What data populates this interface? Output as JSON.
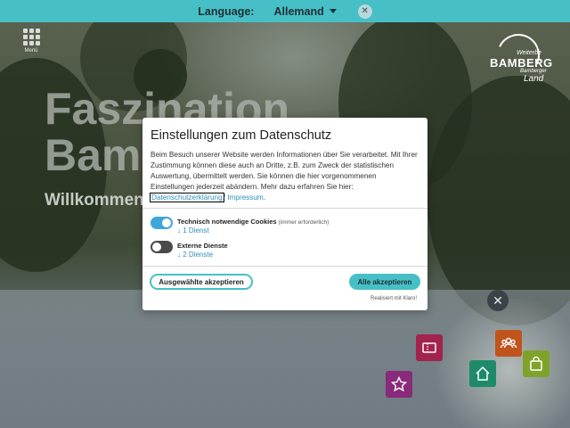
{
  "language_bar": {
    "label": "Language:",
    "selected": "Allemand",
    "close_glyph": "✕",
    "background": "#46c0c6"
  },
  "menu": {
    "label": "Menü"
  },
  "logo": {
    "line1": "Weiterbe",
    "line2": "BAMBERG",
    "line3": "Bamberger",
    "line4": "Land"
  },
  "hero": {
    "line1": "Faszination",
    "line2": "Bam",
    "subtitle": "Willkommen"
  },
  "consent": {
    "title": "Einstellungen zum Datenschutz",
    "description": "Beim Besuch unserer Website werden Informationen über Sie verarbeitet. Mit Ihrer Zustimmung können diese auch an Dritte, z.B. zum Zweck der statistischen Auswertung, übermittelt werden. Sie können die hier vorgenommenen Einstellungen jederzeit abändern. Mehr dazu erfahren Sie hier:",
    "privacy_link": "Datenschutzerklärung",
    "separator": "/",
    "imprint_link": "Impressum",
    "period": ".",
    "services": [
      {
        "name": "Technisch notwendige Cookies",
        "note": "(immer erforderlich)",
        "count": "↓ 1 Dienst",
        "enabled": true
      },
      {
        "name": "Externe Dienste",
        "note": "",
        "count": "↓ 2 Dienste",
        "enabled": false
      }
    ],
    "accept_selected": "Ausgewählte akzeptieren",
    "accept_all": "Alle akzeptieren",
    "powered_by": "Realisiert mit Klaro!",
    "accent_color": "#46c0c6",
    "link_color": "#2d8fb6"
  },
  "quick_nav": {
    "close_glyph": "✕",
    "tiles": [
      {
        "icon": "ticket-icon",
        "color": "#a3234f"
      },
      {
        "icon": "group-icon",
        "color": "#c1541d"
      },
      {
        "icon": "home-icon",
        "color": "#1e8a6a"
      },
      {
        "icon": "shopping-bag-icon",
        "color": "#7fa32a"
      },
      {
        "icon": "star-icon",
        "color": "#8a2a7a"
      }
    ]
  }
}
